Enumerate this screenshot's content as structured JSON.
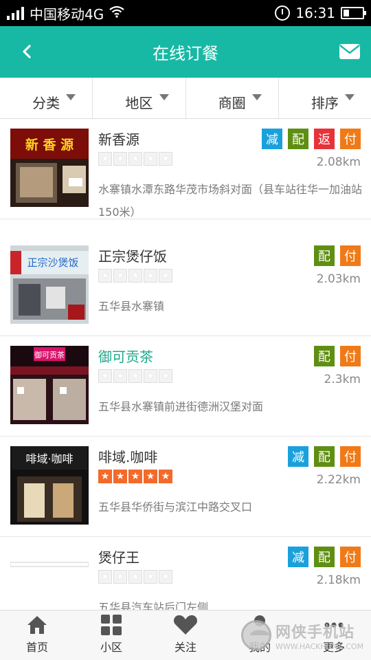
{
  "status_bar": {
    "carrier": "中国移动4G",
    "time": "16:31"
  },
  "header": {
    "title": "在线订餐",
    "back_icon": "chevron-left-icon",
    "mail_icon": "envelope-icon"
  },
  "filters": [
    {
      "label": "分类"
    },
    {
      "label": "地区"
    },
    {
      "label": "商圈"
    },
    {
      "label": "排序"
    }
  ],
  "restaurants": [
    {
      "name": "新香源",
      "rating": 0,
      "distance": "2.08km",
      "address": "水寨镇水潭东路华茂市场斜对面（县车站往华一加油站150米）",
      "badges": [
        "减",
        "配",
        "返",
        "付"
      ],
      "sign_text": "新 香 源"
    },
    {
      "name": "正宗煲仔饭",
      "rating": 0,
      "distance": "2.03km",
      "address": "五华县水寨镇",
      "badges": [
        "配",
        "付"
      ],
      "sign_text": "正宗沙煲饭"
    },
    {
      "name": "御可贡茶",
      "rating": 0,
      "distance": "2.3km",
      "address": "五华县水寨镇前进街德洲汉堡对面",
      "badges": [
        "配",
        "付"
      ],
      "sign_text": "御可贡茶"
    },
    {
      "name": "啡域.咖啡",
      "rating": 5,
      "distance": "2.22km",
      "address": "五华县华侨街与滨江中路交叉口",
      "badges": [
        "减",
        "配",
        "付"
      ],
      "sign_text": "啡域·咖啡"
    },
    {
      "name": "煲仔王",
      "rating": 0,
      "distance": "2.18km",
      "address": "五华县汽车站后门左侧",
      "badges": [
        "减",
        "配",
        "付"
      ],
      "sign_text": ""
    }
  ],
  "bottom_nav": [
    {
      "label": "首页",
      "icon": "home-icon"
    },
    {
      "label": "小区",
      "icon": "grid-icon"
    },
    {
      "label": "关注",
      "icon": "heart-icon"
    },
    {
      "label": "我的",
      "icon": "user-icon"
    },
    {
      "label": "更多",
      "icon": "more-icon"
    }
  ],
  "watermark": {
    "cn": "网侠手机站",
    "en": "WWW.HACKHOME.COM"
  },
  "colors": {
    "primary": "#17b9a4",
    "highlight_name": "#1aa98b",
    "badge_减": "#1aa1dc",
    "badge_配": "#5f8f12",
    "badge_返": "#e7323a",
    "badge_付": "#f07a18",
    "star_on": "#f36a2b"
  }
}
